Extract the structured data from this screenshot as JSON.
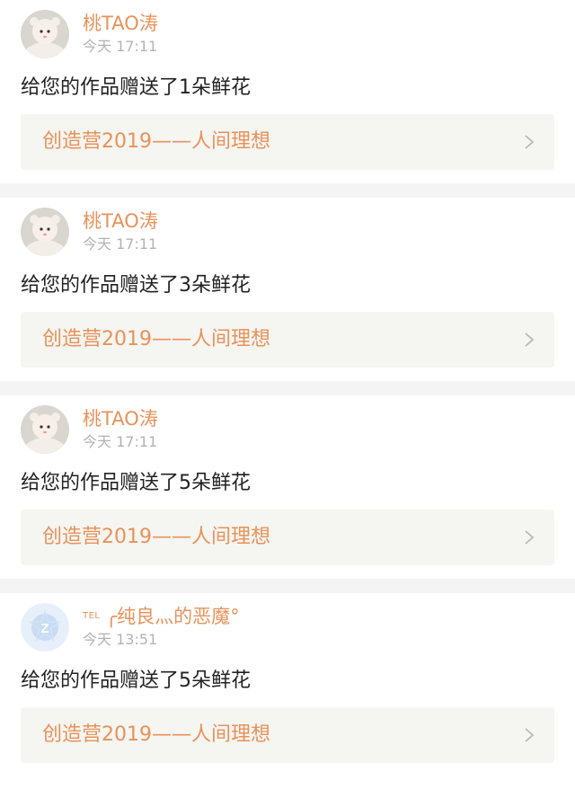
{
  "notifications": [
    {
      "username": "桃TAO涛",
      "tel_badge": "",
      "time": "今天 17:11",
      "message": "给您的作品赠送了1朵鲜花",
      "work_title": "创造营2019——人间理想",
      "avatar": "photo-avatar"
    },
    {
      "username": "桃TAO涛",
      "tel_badge": "",
      "time": "今天 17:11",
      "message": "给您的作品赠送了3朵鲜花",
      "work_title": "创造营2019——人间理想",
      "avatar": "photo-avatar"
    },
    {
      "username": "桃TAO涛",
      "tel_badge": "",
      "time": "今天 17:11",
      "message": "给您的作品赠送了5朵鲜花",
      "work_title": "创造营2019——人间理想",
      "avatar": "photo-avatar"
    },
    {
      "username": "╭纯良灬的恶魔°",
      "tel_badge": "TEL",
      "time": "今天 13:51",
      "message": "给您的作品赠送了5朵鲜花",
      "work_title": "创造营2019——人间理想",
      "avatar": "default-z-avatar"
    }
  ],
  "colors": {
    "accent": "#e8925a",
    "timestamp": "#b3b3b3",
    "card_link_bg": "#f5f5f1",
    "separator": "#f4f4f4"
  },
  "icons": [
    "chevron-right-icon"
  ]
}
